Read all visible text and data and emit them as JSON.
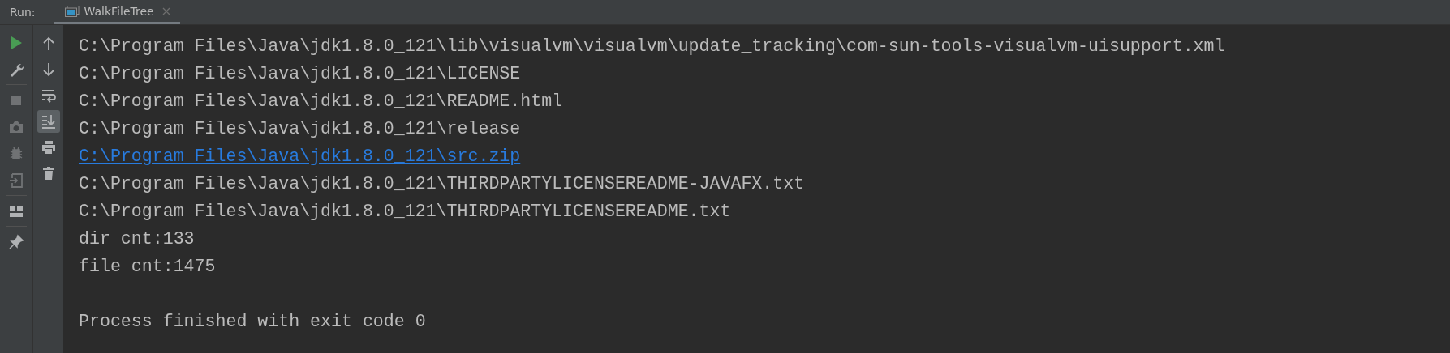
{
  "header": {
    "label": "Run:",
    "tab": {
      "title": "WalkFileTree",
      "selected": true
    }
  },
  "left_toolbar": [
    {
      "items": [
        {
          "kind": "run",
          "disabled": false
        },
        {
          "kind": "wrench",
          "disabled": false
        }
      ]
    },
    {
      "items": [
        {
          "kind": "stop",
          "disabled": true
        },
        {
          "kind": "camera",
          "disabled": true
        },
        {
          "kind": "bug",
          "disabled": true
        },
        {
          "kind": "exit",
          "disabled": true
        }
      ]
    },
    {
      "items": [
        {
          "kind": "layout",
          "disabled": false
        }
      ]
    },
    {
      "items": [
        {
          "kind": "pin",
          "disabled": false
        }
      ]
    }
  ],
  "console_toolbar": [
    {
      "kind": "up",
      "selected": false
    },
    {
      "kind": "down",
      "selected": false
    },
    {
      "kind": "wrap",
      "selected": false
    },
    {
      "kind": "scroll-end",
      "selected": true
    },
    {
      "kind": "print",
      "selected": false
    },
    {
      "kind": "trash",
      "selected": false
    }
  ],
  "console_lines": [
    {
      "kind": "text",
      "text": "C:\\Program Files\\Java\\jdk1.8.0_121\\lib\\visualvm\\visualvm\\update_tracking\\com-sun-tools-visualvm-uisupport.xml"
    },
    {
      "kind": "text",
      "text": "C:\\Program Files\\Java\\jdk1.8.0_121\\LICENSE"
    },
    {
      "kind": "text",
      "text": "C:\\Program Files\\Java\\jdk1.8.0_121\\README.html"
    },
    {
      "kind": "text",
      "text": "C:\\Program Files\\Java\\jdk1.8.0_121\\release"
    },
    {
      "kind": "link",
      "text": "C:\\Program Files\\Java\\jdk1.8.0_121\\src.zip"
    },
    {
      "kind": "text",
      "text": "C:\\Program Files\\Java\\jdk1.8.0_121\\THIRDPARTYLICENSEREADME-JAVAFX.txt"
    },
    {
      "kind": "text",
      "text": "C:\\Program Files\\Java\\jdk1.8.0_121\\THIRDPARTYLICENSEREADME.txt"
    },
    {
      "kind": "text",
      "text": "dir cnt:133"
    },
    {
      "kind": "text",
      "text": "file cnt:1475"
    },
    {
      "kind": "blank"
    },
    {
      "kind": "text",
      "text": "Process finished with exit code 0"
    }
  ]
}
